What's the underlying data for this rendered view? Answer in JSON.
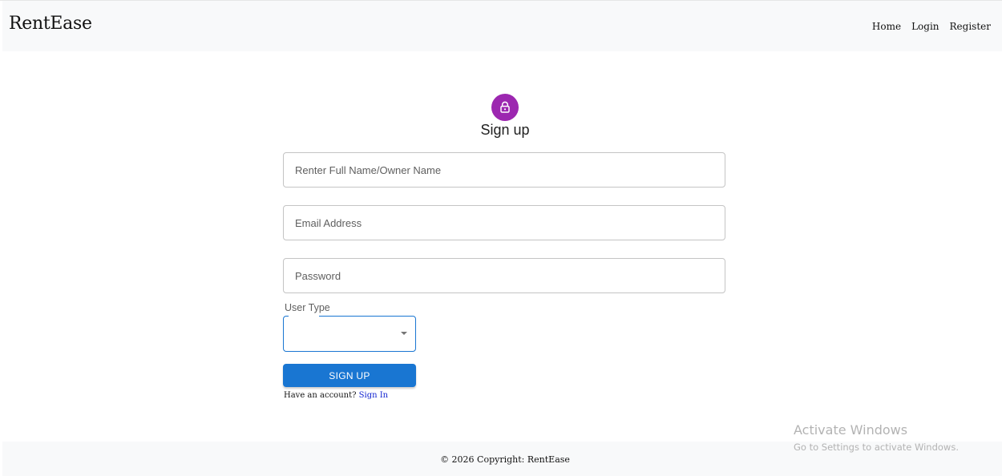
{
  "navbar": {
    "brand": "RentEase",
    "links": [
      "Home",
      "Login",
      "Register"
    ]
  },
  "form": {
    "title": "Sign up",
    "name_placeholder": "Renter Full Name/Owner Name",
    "email_placeholder": "Email Address",
    "password_placeholder": "Password",
    "user_type_label": "User Type",
    "user_type_value": "",
    "submit_label": "SIGN UP",
    "have_account_text": "Have an account?",
    "sign_in_link": "Sign In"
  },
  "footer": {
    "text": "© 2026 Copyright: RentEase"
  },
  "watermark": {
    "title": "Activate Windows",
    "subtitle": "Go to Settings to activate Windows."
  },
  "icons": {
    "lock": "lock-icon",
    "dropdown": "caret-down-icon"
  },
  "colors": {
    "avatar": "#9c27b0",
    "primary": "#1976d2",
    "link": "#0d1fd0",
    "navbar_bg": "#f8f9fa"
  }
}
